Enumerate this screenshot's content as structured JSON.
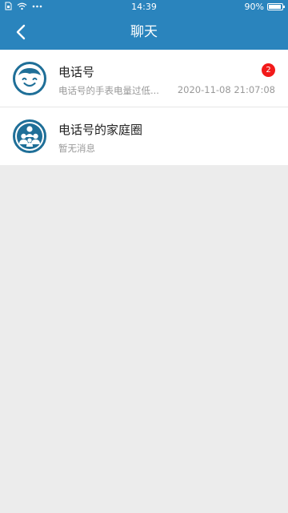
{
  "status_bar": {
    "time": "14:39",
    "battery": "90%",
    "icons": [
      "sim-icon",
      "wifi-icon",
      "more-dots-icon",
      "battery-icon"
    ]
  },
  "header": {
    "title": "聊天",
    "back_icon": "chevron-left-icon"
  },
  "chats": [
    {
      "name": "电话号",
      "preview": "电话号的手表电量过低...",
      "time": "2020-11-08 21:07:08",
      "unread": "2",
      "avatar_icon": "smiley-face-icon"
    },
    {
      "name": "电话号的家庭圈",
      "preview": "暂无消息",
      "avatar_icon": "family-group-icon"
    }
  ],
  "colors": {
    "primary": "#2a84bd",
    "avatar": "#1f6f98",
    "badge": "#f21a1a",
    "background": "#ececec"
  }
}
